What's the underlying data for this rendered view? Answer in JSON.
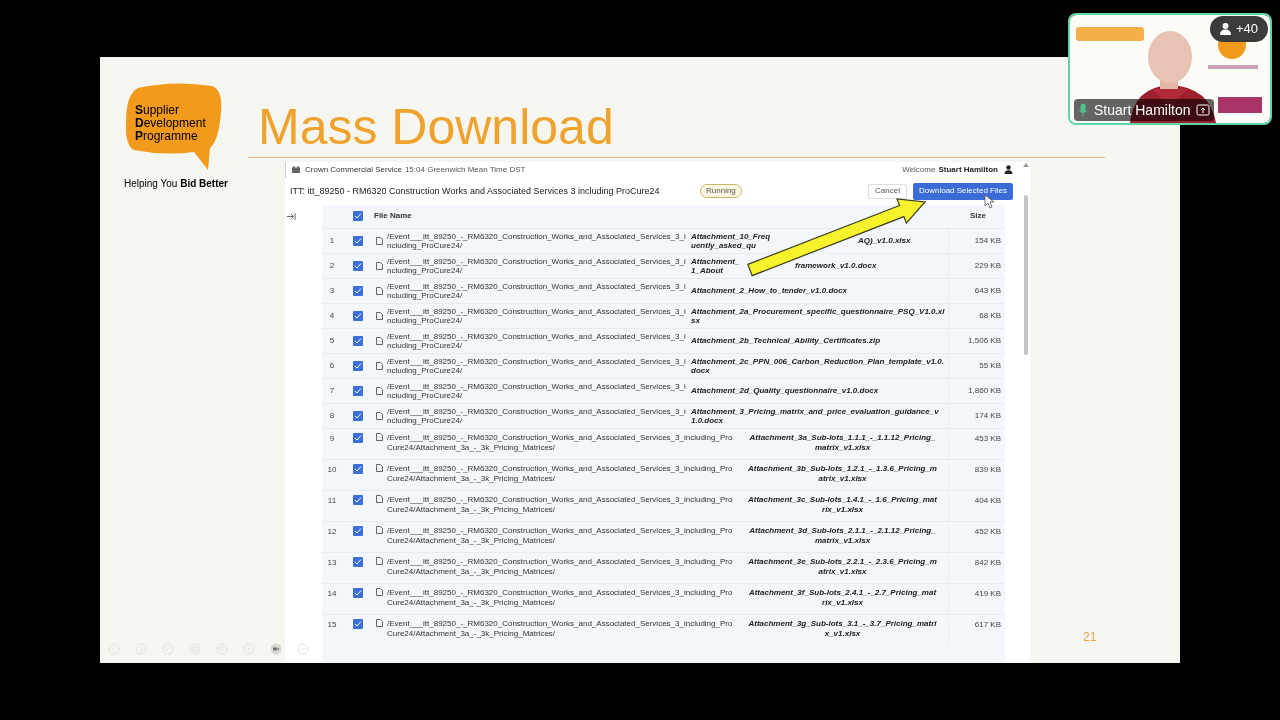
{
  "video_tile": {
    "participant_count": "+40",
    "name": "Stuart Hamilton"
  },
  "slide": {
    "logo": {
      "name": "**S**upplier **D**evelopment **P**rogramme",
      "tagline": "Helping You **Bid Better**"
    },
    "title": "Mass Download",
    "page_number": "21",
    "screenshot": {
      "header": {
        "brand": "Crown Commercial Service",
        "time": "15:04 Greenwich Mean Time DST",
        "welcome": "Welcome",
        "user": "Stuart Hamilton"
      },
      "itt_title": "ITT: itt_89250 - RM6320 Construction Works and Associated Services 3 including ProCure24",
      "status": "Running",
      "buttons": [
        {
          "label": "Cancel",
          "kind": "secondary"
        },
        {
          "label": "Download Selected Files",
          "kind": "primary"
        }
      ],
      "table": {
        "select_all_checked": true,
        "columns": [
          "File Name",
          "Size"
        ],
        "rows": [
          {
            "kind": "single",
            "number": "1",
            "checked": true,
            "path": "/Event___itt_89250_-_RM6320_Construction_Works_and_Associated_Services_3_including_ProCure24/",
            "file": [
              "Attachment_10_Frequently_asked_qu",
              "AQ)_v1.0.xlsx"
            ],
            "size": "154 KB"
          },
          {
            "kind": "single",
            "number": "2",
            "checked": true,
            "path": "/Event___itt_89250_-_RM6320_Construction_Works_and_Associated_Services_3_including_ProCure24/",
            "file": [
              "Attachment_1_About",
              "framework_v1.0.docx"
            ],
            "size": "229 KB"
          },
          {
            "kind": "single",
            "number": "3",
            "checked": true,
            "path": "/Event___itt_89250_-_RM6320_Construction_Works_and_Associated_Services_3_including_ProCure24/",
            "file": [
              "Attachment_2_How_to_tender_v1.0.docx"
            ],
            "size": "643 KB"
          },
          {
            "kind": "single",
            "number": "4",
            "checked": true,
            "path": "/Event___itt_89250_-_RM6320_Construction_Works_and_Associated_Services_3_including_ProCure24/",
            "file": [
              "Attachment_2a_Procurement_specific_questionnaire_PSQ_V1.0.xlsx"
            ],
            "size": "68 KB"
          },
          {
            "kind": "single",
            "number": "5",
            "checked": true,
            "path": "/Event___itt_89250_-_RM6320_Construction_Works_and_Associated_Services_3_including_ProCure24/",
            "file": [
              "Attachment_2b_Technical_Ability_Certificates.zip"
            ],
            "size": "1,506 KB"
          },
          {
            "kind": "single",
            "number": "6",
            "checked": true,
            "path": "/Event___itt_89250_-_RM6320_Construction_Works_and_Associated_Services_3_including_ProCure24/",
            "file": [
              "Attachment_2c_PPN_006_Carbon_Reduction_Plan_template_v1.0.docx"
            ],
            "size": "55 KB"
          },
          {
            "kind": "single",
            "number": "7",
            "checked": true,
            "path": "/Event___itt_89250_-_RM6320_Construction_Works_and_Associated_Services_3_including_ProCure24/",
            "file": [
              "Attachment_2d_Quality_questionnaire_v1.0.docx"
            ],
            "size": "1,860 KB"
          },
          {
            "kind": "single",
            "number": "8",
            "checked": true,
            "path": "/Event___itt_89250_-_RM6320_Construction_Works_and_Associated_Services_3_including_ProCure24/",
            "file": [
              "Attachment_3_Pricing_matrix_and_price_evaluation_guidance_v1.0.docx"
            ],
            "size": "174 KB"
          },
          {
            "kind": "wrapped",
            "number": "9",
            "checked": true,
            "path": "/Event___itt_89250_-_RM6320_Construction_Works_and_Associated_Services_3_including_ProCure24/Attachment_3a_-_3k_Pricing_Matrices/",
            "file": [
              "Attachment_3a_Sub-lots_1.1.1_-_1.1.12_Pricing_matrix_v1.xlsx"
            ],
            "size": "453 KB"
          },
          {
            "kind": "wrapped",
            "number": "10",
            "checked": true,
            "path": "/Event___itt_89250_-_RM6320_Construction_Works_and_Associated_Services_3_including_ProCure24/Attachment_3a_-_3k_Pricing_Matrices/",
            "file": [
              "Attachment_3b_Sub-lots_1.2.1_-_1.3.6_Pricing_matrix_v1.xlsx"
            ],
            "size": "839 KB"
          },
          {
            "kind": "wrapped",
            "number": "11",
            "checked": true,
            "path": "/Event___itt_89250_-_RM6320_Construction_Works_and_Associated_Services_3_including_ProCure24/Attachment_3a_-_3k_Pricing_Matrices/",
            "file": [
              "Attachment_3c_Sub-lots_1.4.1_-_1.6_Pricing_matrix_v1.xlsx"
            ],
            "size": "404 KB"
          },
          {
            "kind": "wrapped",
            "number": "12",
            "checked": true,
            "path": "/Event___itt_89250_-_RM6320_Construction_Works_and_Associated_Services_3_including_ProCure24/Attachment_3a_-_3k_Pricing_Matrices/",
            "file": [
              "Attachment_3d_Sub-lots_2.1.1_-_2.1.12_Pricing_matrix_v1.xlsx"
            ],
            "size": "452 KB"
          },
          {
            "kind": "wrapped",
            "number": "13",
            "checked": true,
            "path": "/Event___itt_89250_-_RM6320_Construction_Works_and_Associated_Services_3_including_ProCure24/Attachment_3a_-_3k_Pricing_Matrices/",
            "file": [
              "Attachment_3e_Sub-lots_2.2.1_-_2.3.6_Pricing_matrix_v1.xlsx"
            ],
            "size": "842 KB"
          },
          {
            "kind": "wrapped",
            "number": "14",
            "checked": true,
            "path": "/Event___itt_89250_-_RM6320_Construction_Works_and_Associated_Services_3_including_ProCure24/Attachment_3a_-_3k_Pricing_Matrices/",
            "file": [
              "Attachment_3f_Sub-lots_2.4.1_-_2.7_Pricing_matrix_v1.xlsx"
            ],
            "size": "419 KB"
          },
          {
            "kind": "wrapped",
            "number": "15",
            "checked": true,
            "path": "/Event___itt_89250_-_RM6320_Construction_Works_and_Associated_Services_3_including_ProCure24/Attachment_3a_-_3k_Pricing_Matrices/",
            "file": [
              "Attachment_3g_Sub-lots_3.1_-_3.7_Pricing_matrix_v1.xlsx"
            ],
            "size": "617 KB"
          }
        ]
      }
    }
  }
}
